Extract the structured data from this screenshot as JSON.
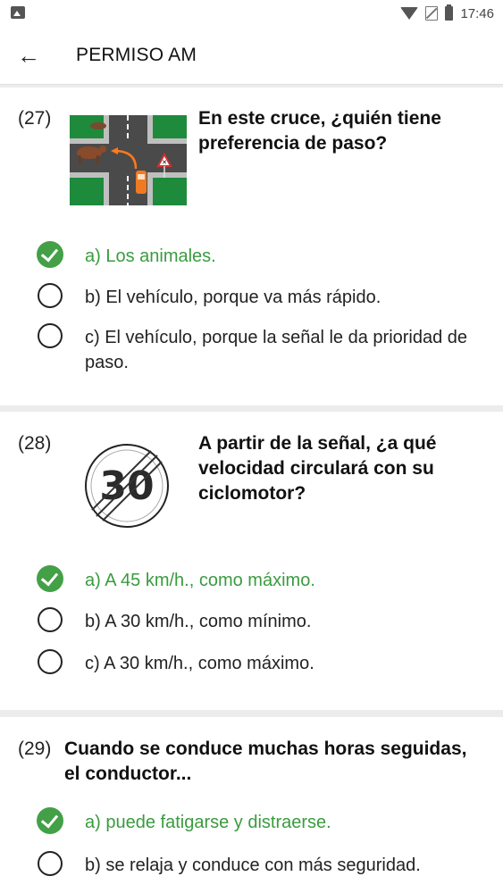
{
  "status": {
    "time": "17:46"
  },
  "app": {
    "title": "PERMISO AM"
  },
  "questions": [
    {
      "num": "(27)",
      "text": "En este cruce, ¿quién tiene preferencia de paso?",
      "answers": [
        {
          "label": "a) Los animales.",
          "correct": true
        },
        {
          "label": "b) El vehículo, porque va más rápido.",
          "correct": false
        },
        {
          "label": "c) El vehículo, porque la señal le da prioridad de paso.",
          "correct": false
        }
      ]
    },
    {
      "num": "(28)",
      "text": "A partir de la señal, ¿a qué velocidad circulará con su ciclomotor?",
      "sign_value": "30",
      "answers": [
        {
          "label": "a) A 45 km/h., como máximo.",
          "correct": true
        },
        {
          "label": "b) A 30 km/h., como mínimo.",
          "correct": false
        },
        {
          "label": "c) A 30 km/h., como máximo.",
          "correct": false
        }
      ]
    },
    {
      "num": "(29)",
      "text": "Cuando se conduce muchas horas seguidas, el conductor...",
      "answers": [
        {
          "label": "a) puede fatigarse y distraerse.",
          "correct": true
        },
        {
          "label": "b) se relaja y conduce con más seguridad.",
          "correct": false
        }
      ]
    }
  ],
  "colors": {
    "correct": "#43a047",
    "correct_text": "#3a9b3f"
  }
}
